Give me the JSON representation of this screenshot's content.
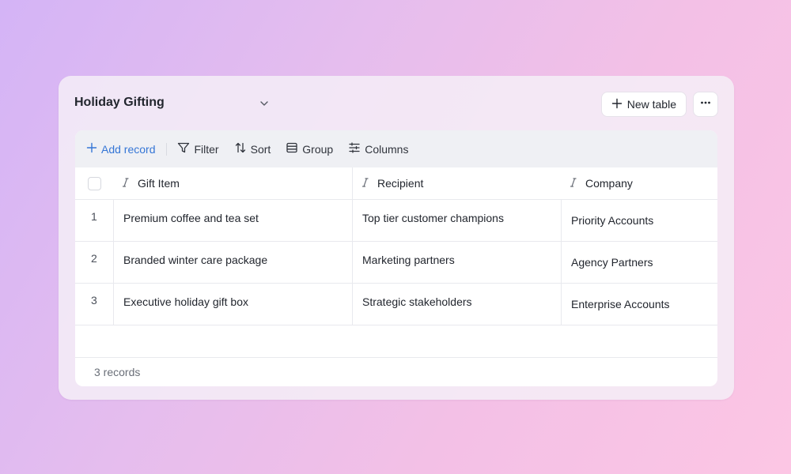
{
  "header": {
    "title": "Holiday Gifting",
    "new_table_label": "New table"
  },
  "toolbar": {
    "add_record": "Add record",
    "filter": "Filter",
    "sort": "Sort",
    "group": "Group",
    "columns": "Columns"
  },
  "table": {
    "columns": [
      "Gift Item",
      "Recipient",
      "Company"
    ],
    "rows": [
      {
        "num": "1",
        "gift_item": "Premium coffee and tea set",
        "recipient": "Top tier customer champions",
        "company": "Priority Accounts"
      },
      {
        "num": "2",
        "gift_item": "Branded winter care package",
        "recipient": "Marketing partners",
        "company": "Agency Partners"
      },
      {
        "num": "3",
        "gift_item": "Executive holiday gift box",
        "recipient": "Strategic stakeholders",
        "company": "Enterprise Accounts"
      }
    ],
    "footer": "3 records"
  },
  "colors": {
    "accent": "#3576d6",
    "text": "#22262e",
    "toolbar_bg": "#eff0f4"
  },
  "icons": {
    "title_dropdown": "chevron-down-icon",
    "new_table": "plus-icon",
    "more": "more-horizontal-icon",
    "add_record": "plus-icon",
    "filter": "filter-icon",
    "sort": "sort-icon",
    "group": "group-icon",
    "columns": "columns-icon",
    "column_type": "text-type-icon"
  }
}
